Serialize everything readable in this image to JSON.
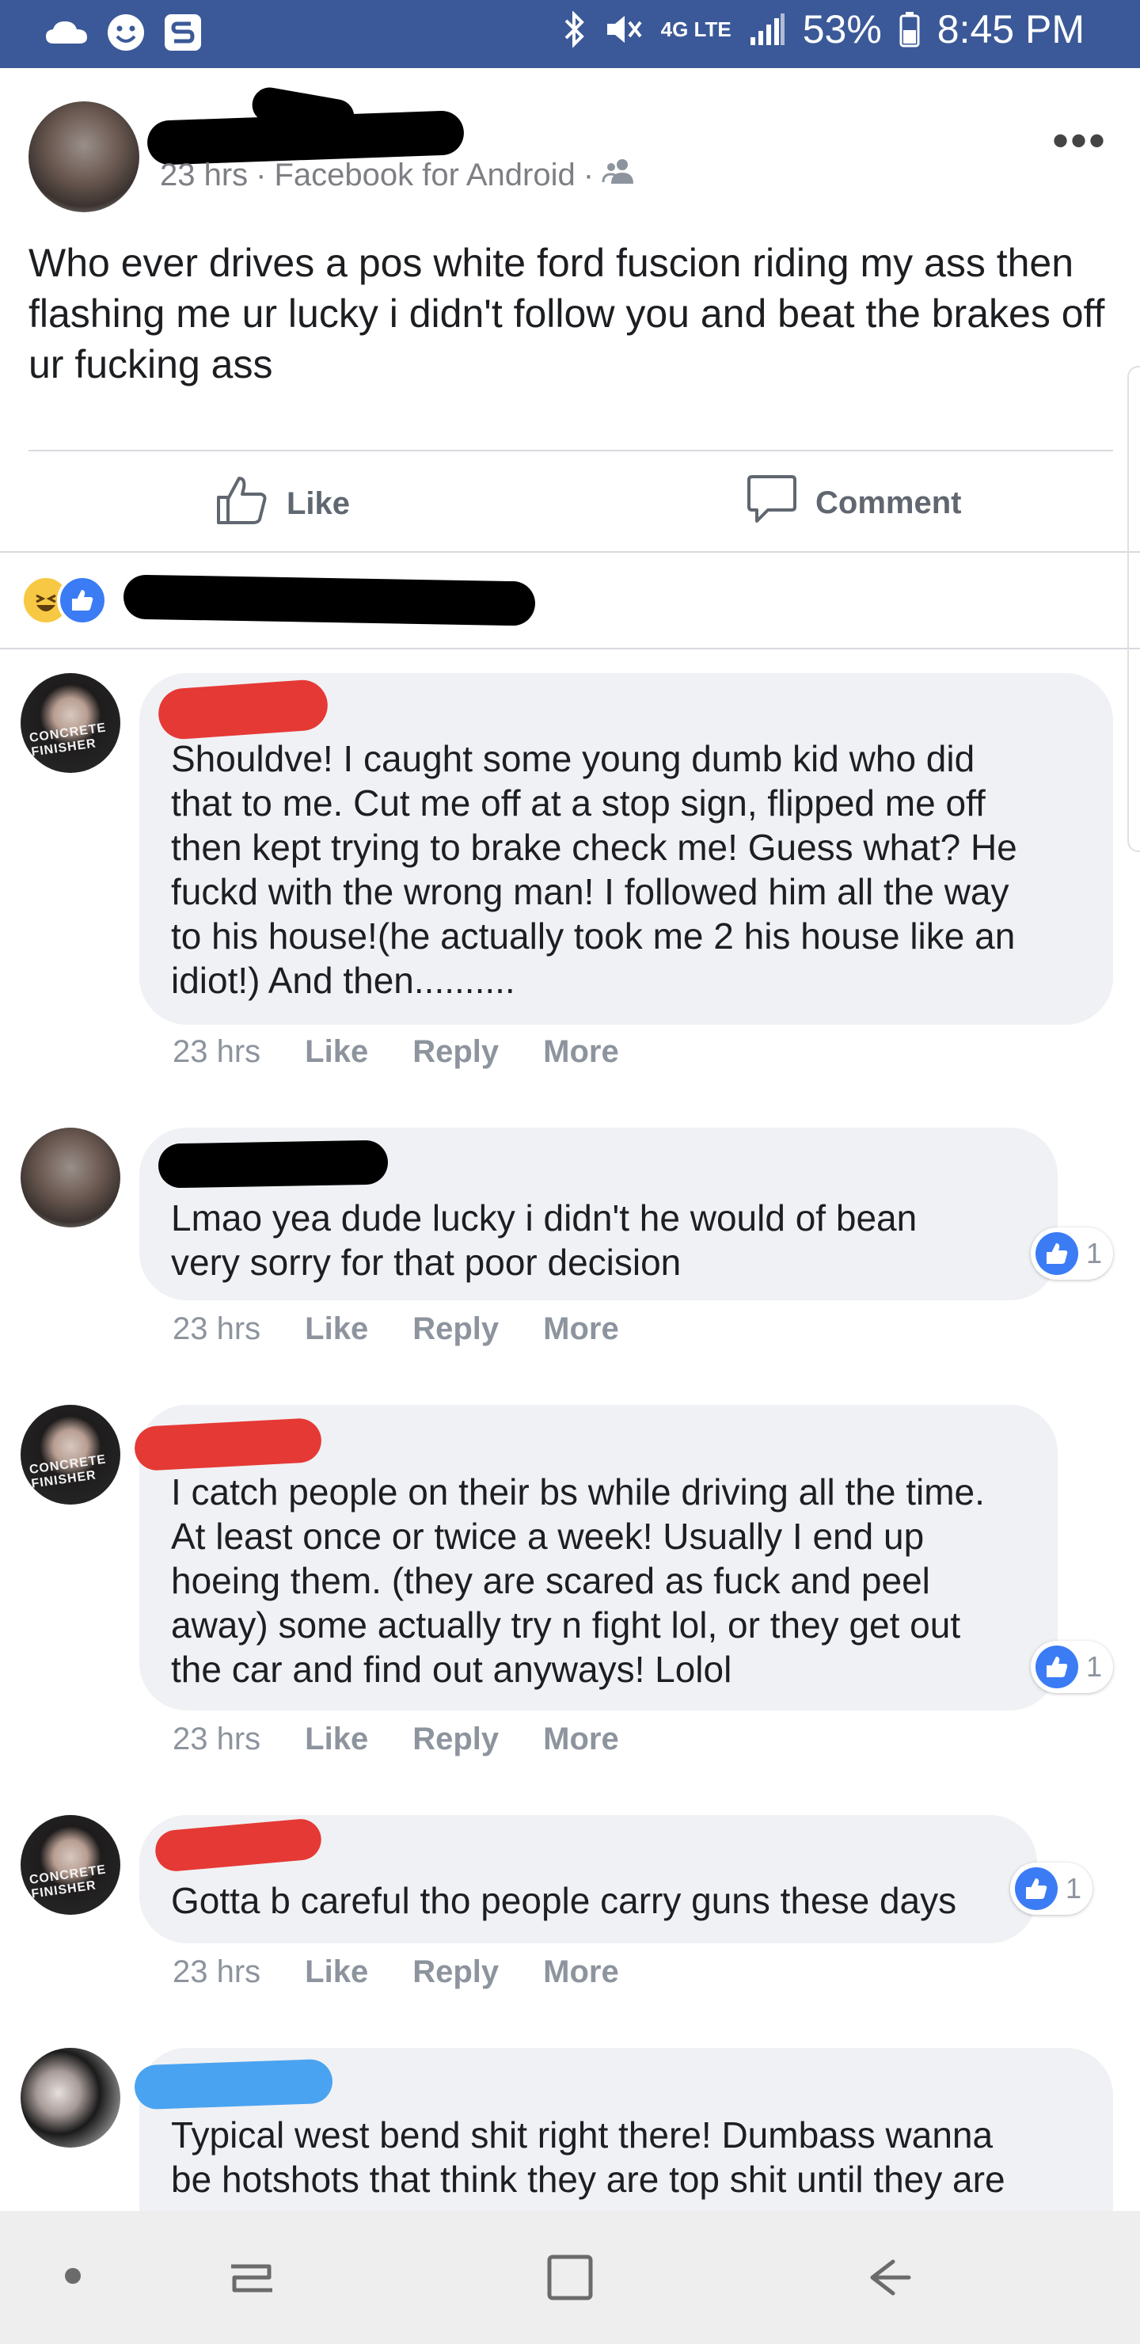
{
  "status_bar": {
    "battery": "53%",
    "time": "8:45 PM",
    "network": "4G LTE",
    "icons": [
      "cloud-icon",
      "smiley-icon",
      "swiftkey-icon",
      "bluetooth-icon",
      "mute-icon",
      "signal-icon",
      "battery-icon"
    ]
  },
  "post": {
    "time": "23 hrs",
    "source": "Facebook for Android",
    "separator": "·",
    "body": "Who ever drives a pos white ford fuscion riding my ass then flashing me ur lucky i didn't follow you and beat the brakes off ur fucking ass",
    "like_label": "Like",
    "comment_label": "Comment",
    "more_icon": "more-dots-icon"
  },
  "comments": [
    {
      "text": "Shouldve! I caught some young dumb kid who did that to me. Cut me off at a stop sign, flipped me off then kept trying to brake check me! Guess what? He fuckd with the wrong man! I followed him all the way to his house!(he actually took me 2 his house like an idiot!) And then..........",
      "time": "23 hrs",
      "like": "Like",
      "reply": "Reply",
      "more": "More"
    },
    {
      "text": "Lmao yea dude lucky i didn't he would of bean very sorry for that poor decision",
      "time": "23 hrs",
      "like": "Like",
      "reply": "Reply",
      "more": "More",
      "like_count": "1"
    },
    {
      "text": "I catch people on their bs while driving all the time. At least once or twice a week! Usually I end up hoeing them. (they are scared as fuck and peel away) some actually try n fight lol, or they get out the car and find out anyways! Lolol",
      "time": "23 hrs",
      "like": "Like",
      "reply": "Reply",
      "more": "More",
      "like_count": "1"
    },
    {
      "text": "Gotta b careful tho people carry guns these days",
      "time": "23 hrs",
      "like": "Like",
      "reply": "Reply",
      "more": "More",
      "like_count": "1"
    },
    {
      "text": "Typical west bend shit right there! Dumbass wanna be hotshots that think they are top shit until they are"
    }
  ],
  "avatar_labels": {
    "concrete": "CONCRETE FINISHER"
  },
  "colors": {
    "facebook_blue": "#3b5998",
    "like_blue": "#3b7cf5",
    "bubble_gray": "#f0f1f4",
    "redact_red": "#e53935",
    "redact_blue": "#4aa3f0"
  }
}
